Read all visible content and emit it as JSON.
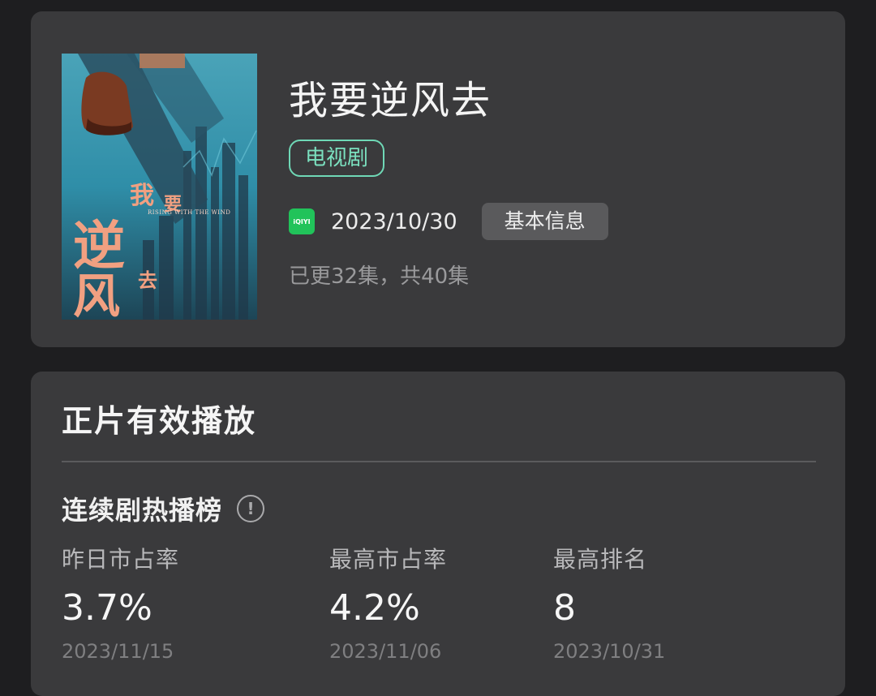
{
  "show": {
    "title": "我要逆风去",
    "type_tag": "电视剧",
    "platform_icon": "iqiyi-icon",
    "platform_icon_text": "iQIYI",
    "release_date": "2023/10/30",
    "info_button": "基本信息",
    "episodes_status": "已更32集，共40集",
    "poster": {
      "title_chars": [
        "我",
        "要",
        "逆",
        "风",
        "去"
      ],
      "english_title": "RISING WITH THE WIND"
    }
  },
  "section": {
    "title": "正片有效播放",
    "ranking_title": "连续剧热播榜",
    "stats": [
      {
        "label": "昨日市占率",
        "value": "3.7%",
        "date": "2023/11/15"
      },
      {
        "label": "最高市占率",
        "value": "4.2%",
        "date": "2023/11/06"
      },
      {
        "label": "最高排名",
        "value": "8",
        "date": "2023/10/31"
      }
    ]
  },
  "colors": {
    "background": "#1e1e20",
    "card": "#3a3a3c",
    "accent_green": "#6fd8b6",
    "iqiyi_green": "#21c35a"
  }
}
